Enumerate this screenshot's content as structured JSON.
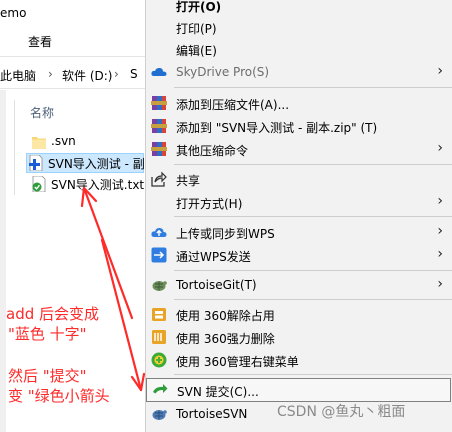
{
  "explorer": {
    "title_fragment": "emo",
    "ribbon_tab": "查看",
    "breadcrumb": [
      "此电脑",
      "›",
      "软件 (D:)",
      "›",
      "S"
    ],
    "column_header": "名称",
    "files": [
      {
        "name": ".svn",
        "icon": "folder-icon"
      },
      {
        "name": "SVN导入测试 - 副",
        "icon": "svn-added-file-icon",
        "selected": true
      },
      {
        "name": "SVN导入测试.txt",
        "icon": "svn-normal-file-icon"
      }
    ]
  },
  "annotations": {
    "line1": "add 后会变成",
    "line2": "\"蓝色  十字\"",
    "line3": "然后 \"提交\"",
    "line4": "变 \"绿色小箭头"
  },
  "colors": {
    "annotation": "#ff2a2a",
    "menu_bg": "#f2f2f2",
    "selected_row": "#cce8ff"
  },
  "menu": {
    "items": [
      {
        "label": "打开(O)",
        "bold": true,
        "icon": "",
        "submenu": false
      },
      {
        "label": "打印(P)",
        "icon": "",
        "submenu": false
      },
      {
        "label": "编辑(E)",
        "icon": "",
        "submenu": false
      },
      {
        "label": "SkyDrive Pro(S)",
        "icon": "skydrive-cloud-icon",
        "submenu": true,
        "disabled": true
      },
      {
        "label": "添加到压缩文件(A)...",
        "icon": "winrar-archive-icon",
        "submenu": false
      },
      {
        "label": "添加到 \"SVN导入测试 - 副本.zip\" (T)",
        "icon": "winrar-archive-icon",
        "submenu": false
      },
      {
        "label": "其他压缩命令",
        "icon": "winrar-archive-icon",
        "submenu": true
      },
      {
        "label": "共享",
        "icon": "share-icon",
        "submenu": false
      },
      {
        "label": "打开方式(H)",
        "icon": "",
        "submenu": true
      },
      {
        "label": "上传或同步到WPS",
        "icon": "wps-cloud-upload-icon",
        "submenu": true
      },
      {
        "label": "通过WPS发送",
        "icon": "wps-send-icon",
        "submenu": true
      },
      {
        "label": "TortoiseGit(T)",
        "icon": "tortoisegit-icon",
        "submenu": true
      },
      {
        "label": "使用 360解除占用",
        "icon": "360-unlock-icon",
        "submenu": false
      },
      {
        "label": "使用 360强力删除",
        "icon": "360-shred-icon",
        "submenu": false
      },
      {
        "label": "使用 360管理右键菜单",
        "icon": "360-menu-manager-icon",
        "submenu": false
      },
      {
        "label": "SVN 提交(C)...",
        "icon": "svn-commit-icon",
        "submenu": false,
        "highlighted": true
      },
      {
        "label": "TortoiseSVN",
        "icon": "tortoisesvn-icon",
        "submenu": true
      }
    ]
  },
  "watermark": "CSDN @鱼丸丶粗面"
}
